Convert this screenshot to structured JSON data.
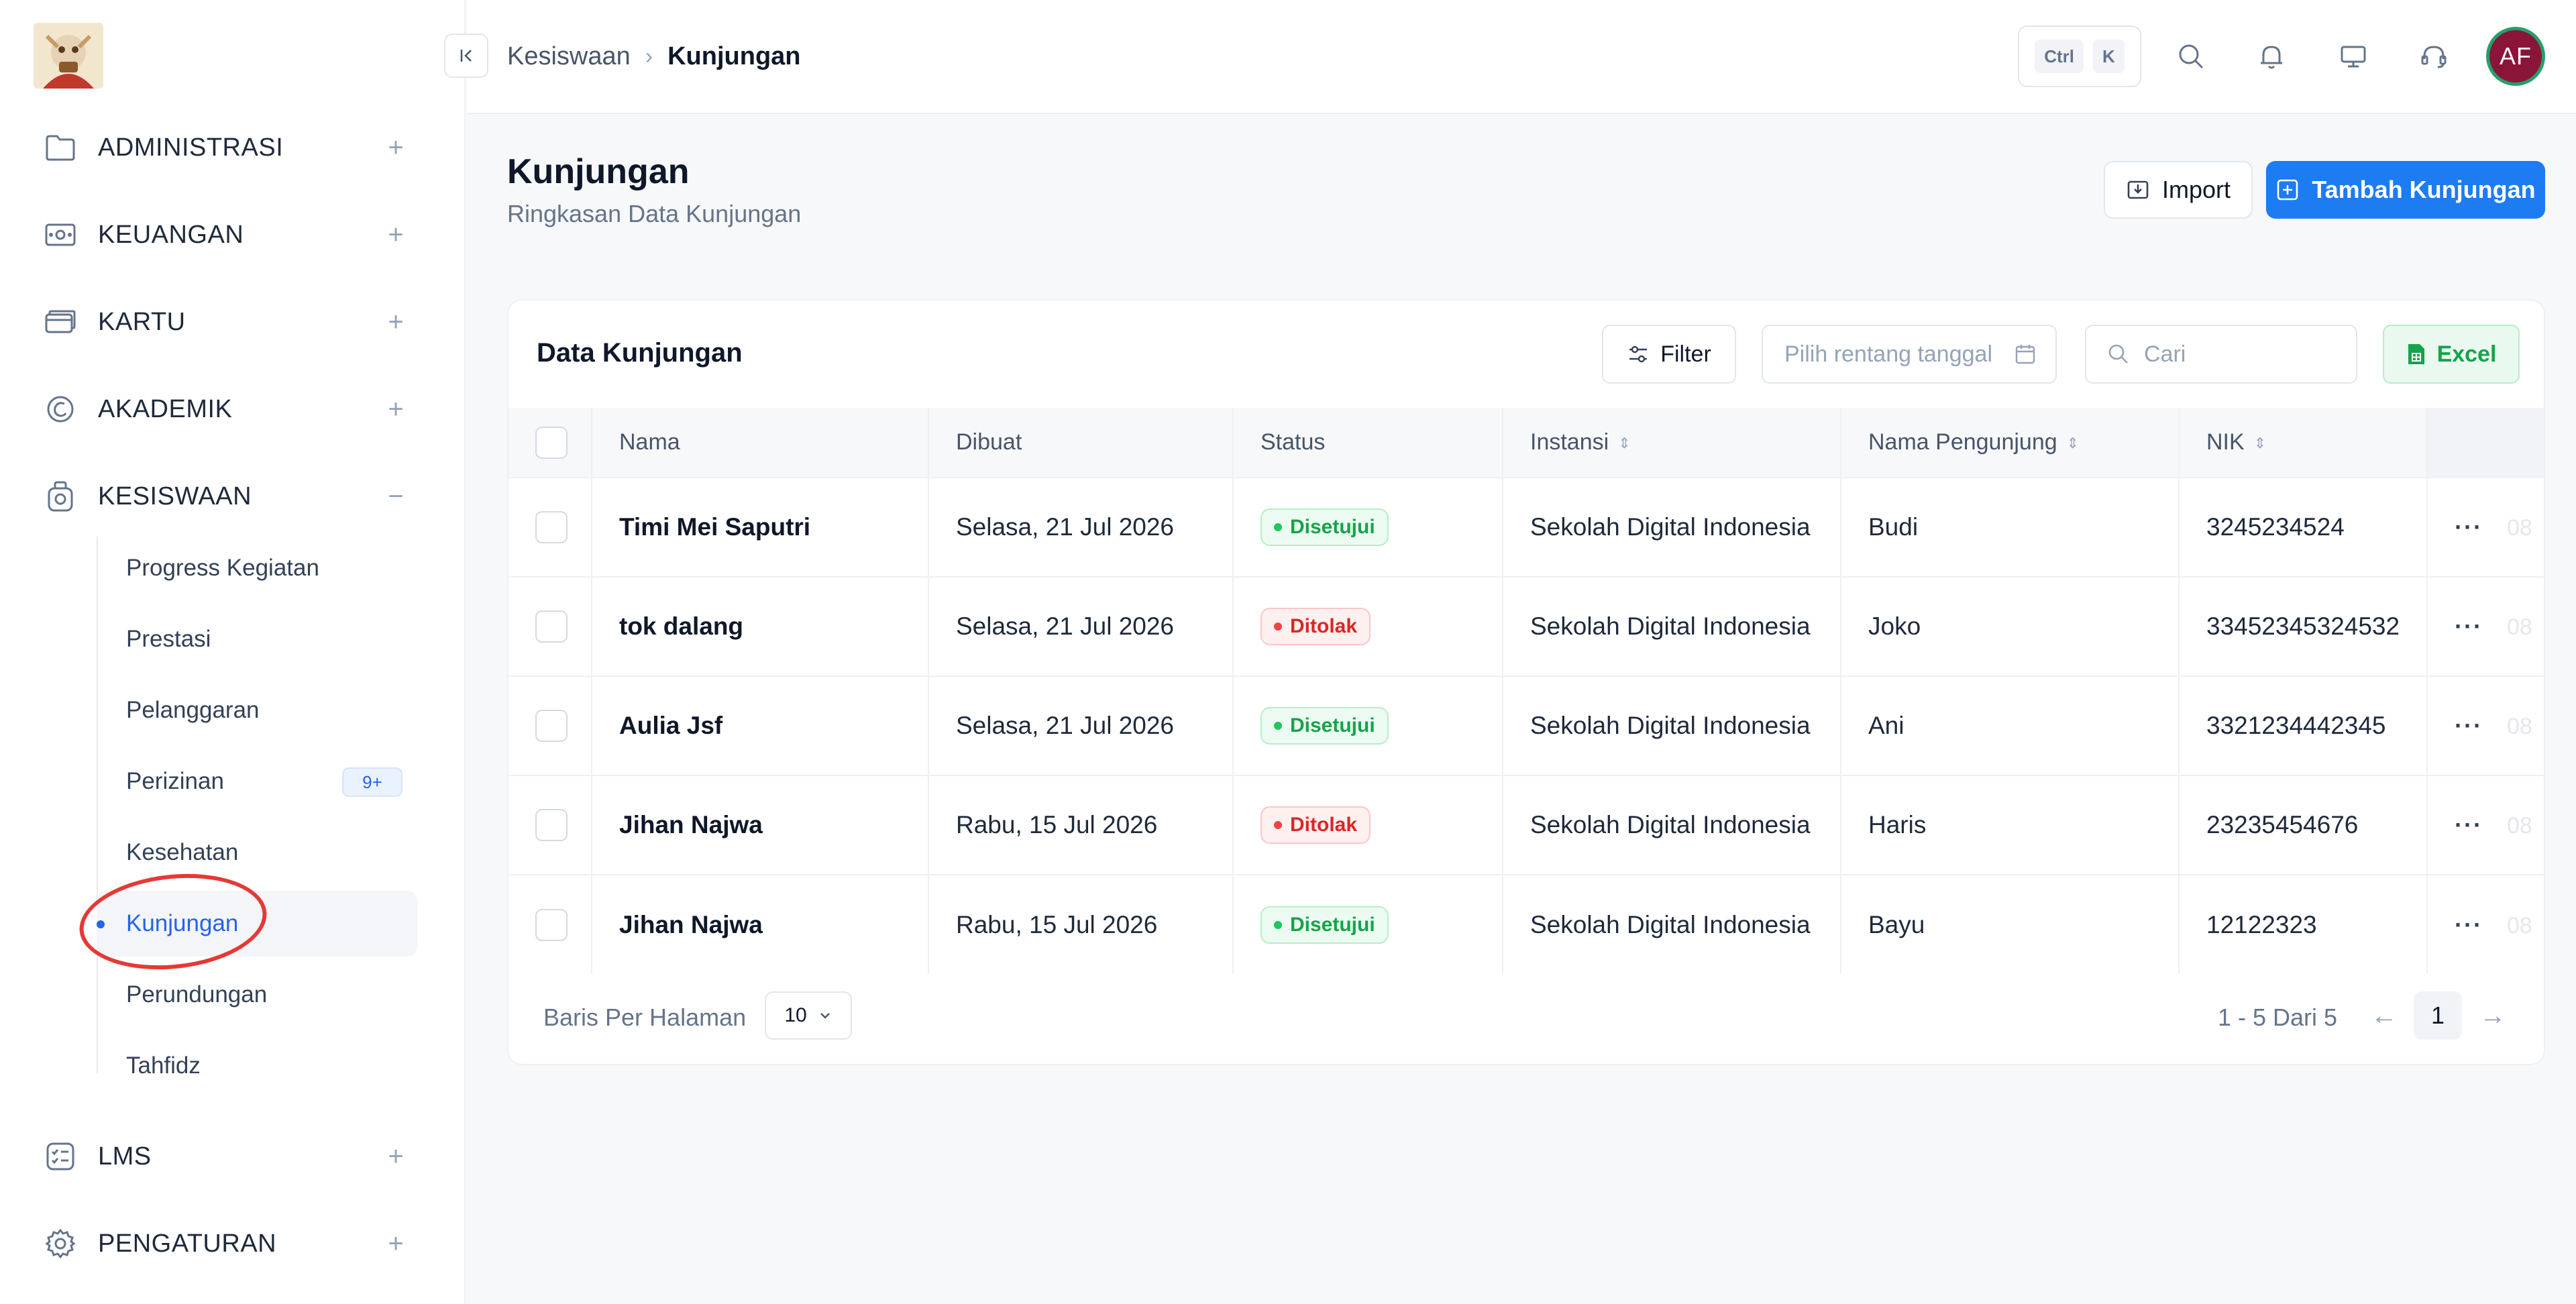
{
  "sidebar": {
    "groups": [
      {
        "label": "ADMINISTRASI",
        "toggle": "+"
      },
      {
        "label": "KEUANGAN",
        "toggle": "+"
      },
      {
        "label": "KARTU",
        "toggle": "+"
      },
      {
        "label": "AKADEMIK",
        "toggle": "+"
      },
      {
        "label": "KESISWAAN",
        "toggle": "−"
      },
      {
        "label": "LMS",
        "toggle": "+"
      },
      {
        "label": "PENGATURAN",
        "toggle": "+"
      }
    ],
    "kesiswaan_items": [
      {
        "label": "Progress Kegiatan"
      },
      {
        "label": "Prestasi"
      },
      {
        "label": "Pelanggaran"
      },
      {
        "label": "Perizinan",
        "badge": "9+"
      },
      {
        "label": "Kesehatan"
      },
      {
        "label": "Kunjungan"
      },
      {
        "label": "Perundungan"
      },
      {
        "label": "Tahfidz"
      }
    ]
  },
  "topbar": {
    "breadcrumb": [
      "Kesiswaan",
      "Kunjungan"
    ],
    "shortcut_keys": [
      "Ctrl",
      "K"
    ],
    "avatar_initials": "AF"
  },
  "page": {
    "title": "Kunjungan",
    "subtitle": "Ringkasan Data Kunjungan",
    "import_label": "Import",
    "add_label": "Tambah Kunjungan"
  },
  "card": {
    "title": "Data Kunjungan",
    "filter_label": "Filter",
    "date_placeholder": "Pilih rentang tanggal",
    "search_placeholder": "Cari",
    "excel_label": "Excel"
  },
  "table": {
    "headers": [
      "Nama",
      "Dibuat",
      "Status",
      "Instansi",
      "Nama Pengunjung",
      "NIK"
    ],
    "rows": [
      {
        "nama": "Timi Mei Saputri",
        "dibuat": "Selasa, 21 Jul 2026",
        "status": "Disetujui",
        "status_type": "ok",
        "instansi": "Sekolah Digital Indonesia",
        "pengunjung": "Budi",
        "nik": "3245234524",
        "extra": "08"
      },
      {
        "nama": "tok dalang",
        "dibuat": "Selasa, 21 Jul 2026",
        "status": "Ditolak",
        "status_type": "no",
        "instansi": "Sekolah Digital Indonesia",
        "pengunjung": "Joko",
        "nik": "33452345324532",
        "extra": "08"
      },
      {
        "nama": "Aulia Jsf",
        "dibuat": "Selasa, 21 Jul 2026",
        "status": "Disetujui",
        "status_type": "ok",
        "instansi": "Sekolah Digital Indonesia",
        "pengunjung": "Ani",
        "nik": "3321234442345",
        "extra": "08"
      },
      {
        "nama": "Jihan Najwa",
        "dibuat": "Rabu, 15 Jul 2026",
        "status": "Ditolak",
        "status_type": "no",
        "instansi": "Sekolah Digital Indonesia",
        "pengunjung": "Haris",
        "nik": "23235454676",
        "extra": "08"
      },
      {
        "nama": "Jihan Najwa",
        "dibuat": "Rabu, 15 Jul 2026",
        "status": "Disetujui",
        "status_type": "ok",
        "instansi": "Sekolah Digital Indonesia",
        "pengunjung": "Bayu",
        "nik": "12122323",
        "extra": "08"
      }
    ]
  },
  "pagination": {
    "rows_label": "Baris Per Halaman",
    "per_page": "10",
    "range": "1 - 5 Dari 5",
    "current_page": "1"
  },
  "colors": {
    "accent": "#1d7cf2",
    "approved": "#16a34a",
    "rejected": "#dc2626",
    "avatar": "#8b1538"
  }
}
